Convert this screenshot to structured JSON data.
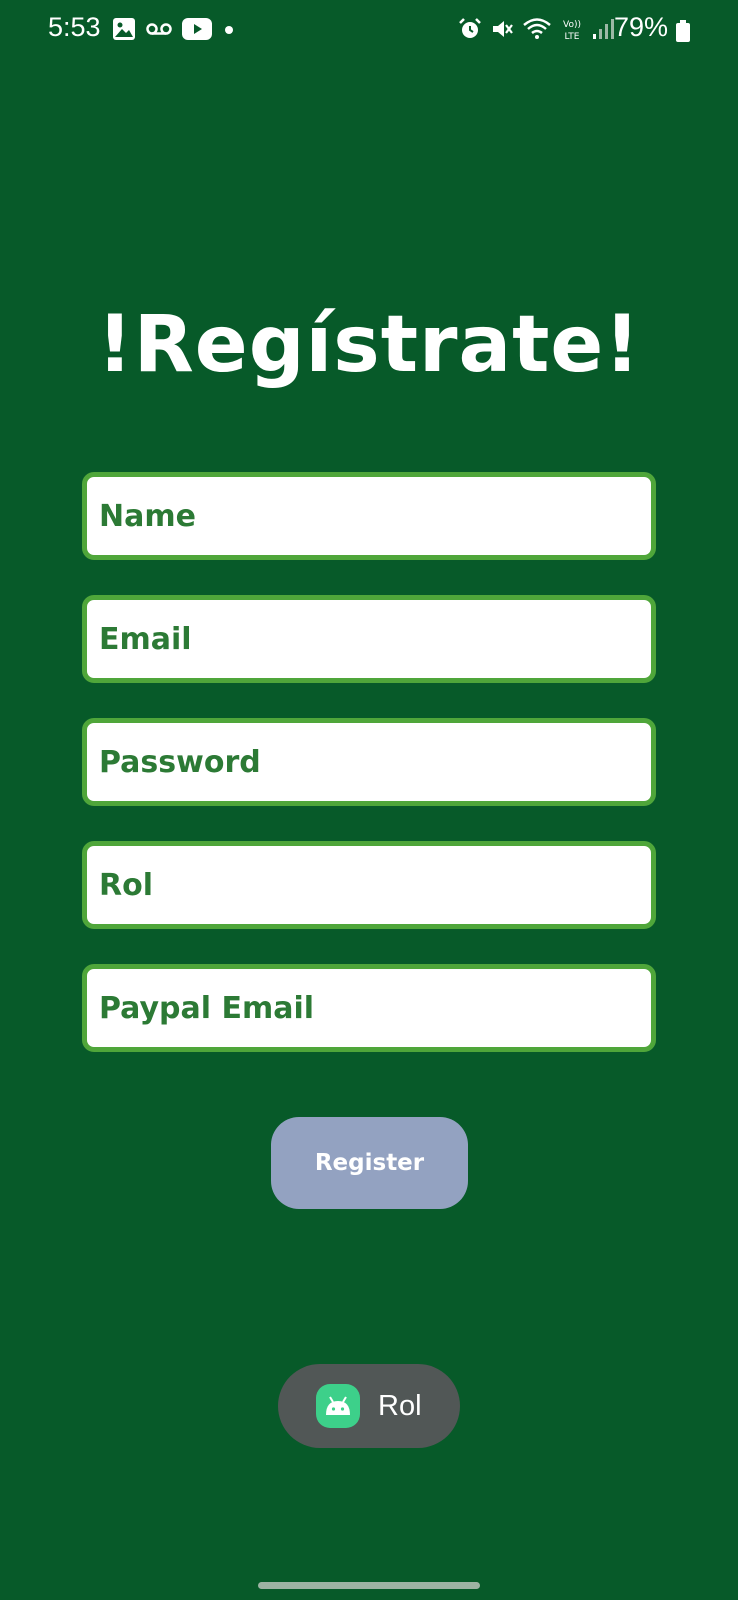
{
  "status_bar": {
    "time": "5:53",
    "battery": "79%",
    "left_icons": [
      "gallery-icon",
      "voicemail-icon",
      "youtube-icon",
      "notification-dot-icon"
    ],
    "right_icons": [
      "alarm-icon",
      "mute-icon",
      "wifi-icon",
      "volte-icon",
      "signal-icon",
      "battery-icon"
    ]
  },
  "title": "!Regístrate!",
  "form": {
    "name_placeholder": "Name",
    "email_placeholder": "Email",
    "password_placeholder": "Password",
    "rol_placeholder": "Rol",
    "paypal_email_placeholder": "Paypal Email"
  },
  "register_label": "Register",
  "toast": {
    "text": "Rol",
    "icon": "android-app-icon"
  },
  "colors": {
    "background": "#075A29",
    "field_border": "#4FA63A",
    "field_text": "#2C7A35",
    "button": "#93A2C1",
    "toast": "#515756"
  }
}
